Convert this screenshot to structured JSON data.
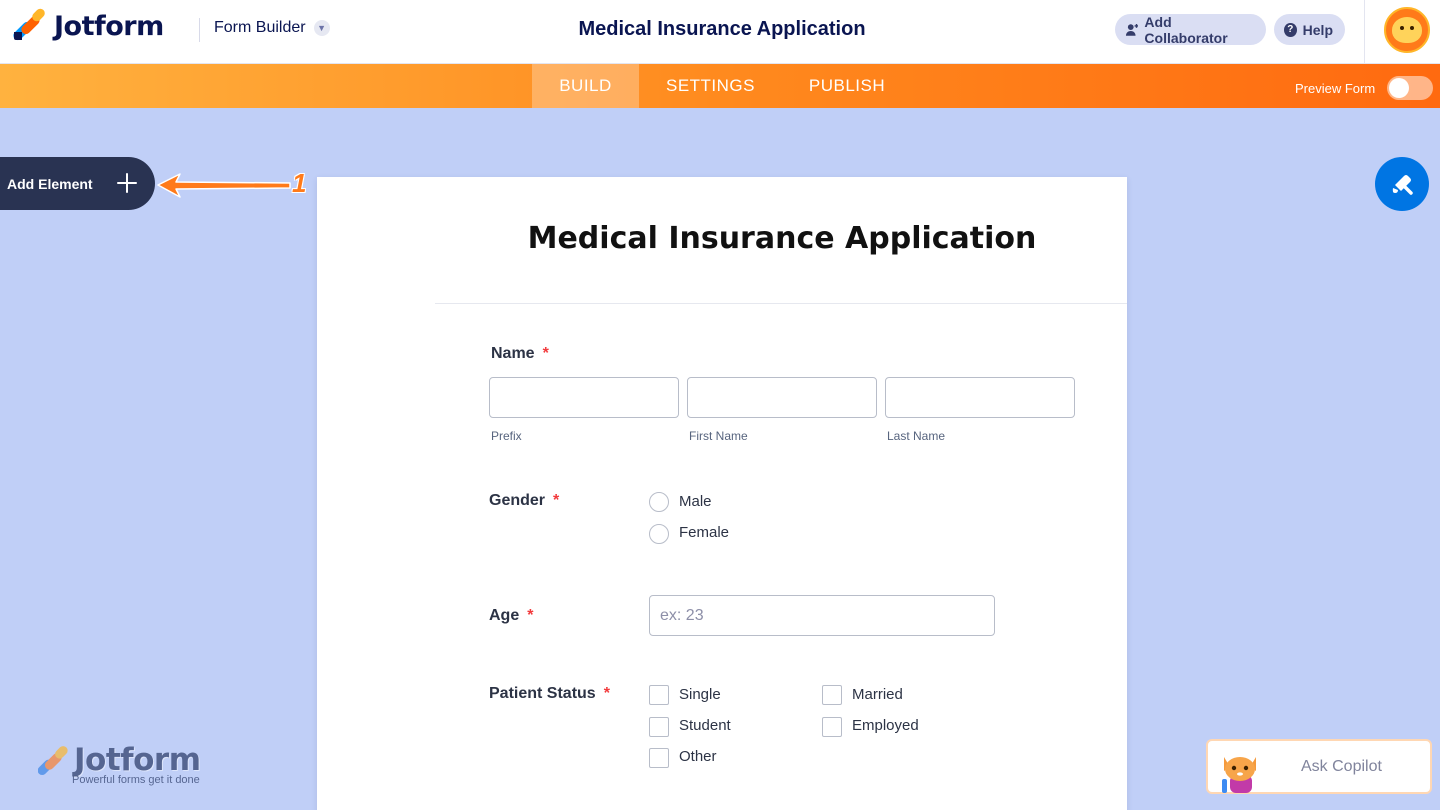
{
  "header": {
    "brand": "Jotform",
    "builder_menu": "Form Builder",
    "title": "Medical Insurance Application",
    "add_collaborator": "Add Collaborator",
    "help": "Help"
  },
  "nav": {
    "tabs": [
      "BUILD",
      "SETTINGS",
      "PUBLISH"
    ],
    "active_tab": "BUILD",
    "preview_label": "Preview Form",
    "preview_enabled": false
  },
  "sidebar": {
    "add_element": "Add Element",
    "annotation_number": "1"
  },
  "form": {
    "title": "Medical Insurance Application",
    "name_field": {
      "label": "Name",
      "required_mark": "*",
      "sublabels": [
        "Prefix",
        "First Name",
        "Last Name"
      ]
    },
    "gender_field": {
      "label": "Gender",
      "required_mark": "*",
      "options": [
        "Male",
        "Female"
      ]
    },
    "age_field": {
      "label": "Age",
      "required_mark": "*",
      "placeholder": "ex: 23"
    },
    "patient_status_field": {
      "label": "Patient Status",
      "required_mark": "*",
      "options": [
        "Single",
        "Married",
        "Student",
        "Employed",
        "Other"
      ]
    }
  },
  "watermark": {
    "brand": "Jotform",
    "tagline": "Powerful forms get it done"
  },
  "copilot": {
    "label": "Ask Copilot"
  },
  "colors": {
    "canvas_bg": "#c0cff7",
    "brand_navy": "#0a1551",
    "nav_orange": "#ff6a10",
    "required_red": "#f23a3c",
    "designer_blue": "#0075e3"
  }
}
